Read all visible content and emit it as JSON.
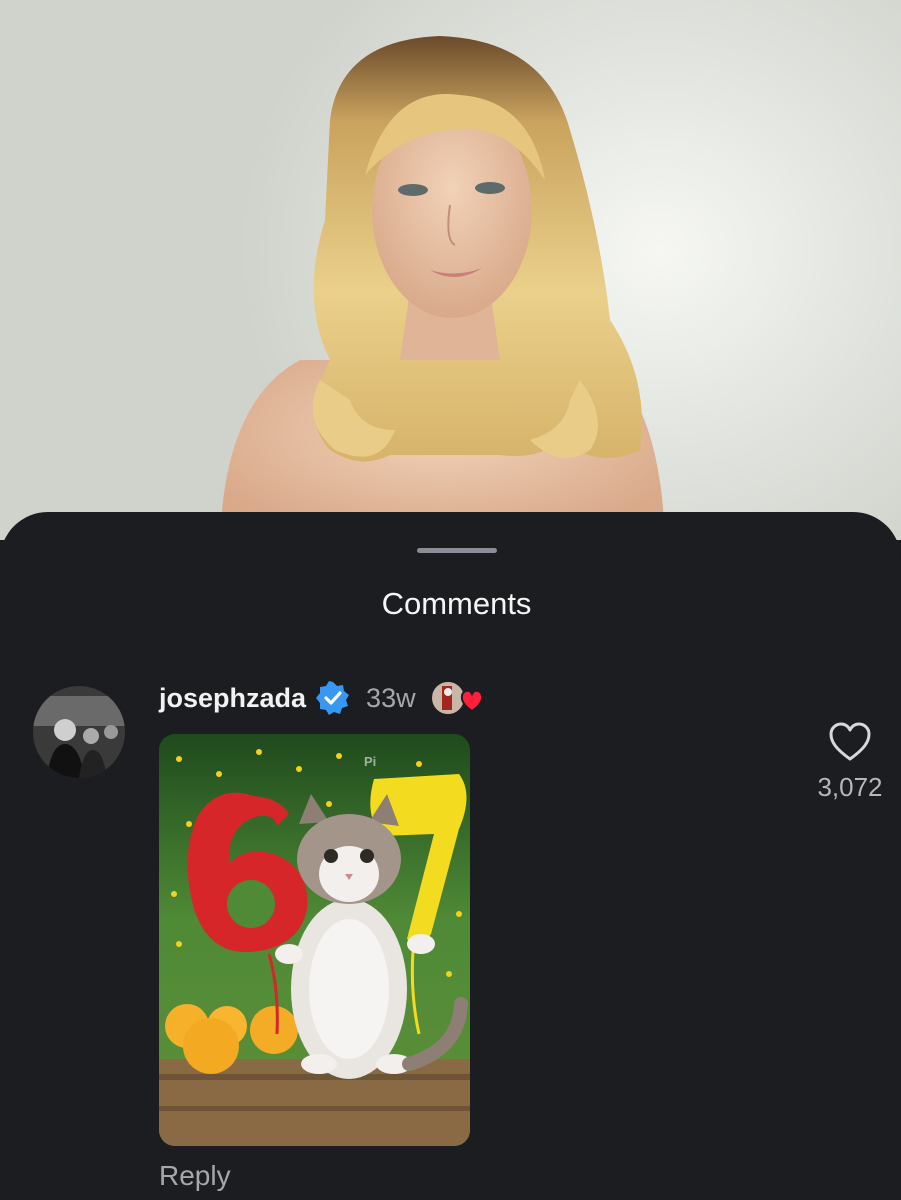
{
  "sheet": {
    "title": "Comments"
  },
  "comment": {
    "username": "josephzada",
    "verified": true,
    "time": "33w",
    "likes": "3,072",
    "reply_label": "Reply",
    "gif_watermark": "Pi"
  },
  "icons": {
    "verified": "verified-badge-icon",
    "like": "heart-outline-icon",
    "creator_liked": "creator-liked-heart-icon"
  },
  "colors": {
    "sheet_bg": "#1b1d21",
    "verified_blue": "#3897f0",
    "creator_heart": "#ff1f3d"
  }
}
